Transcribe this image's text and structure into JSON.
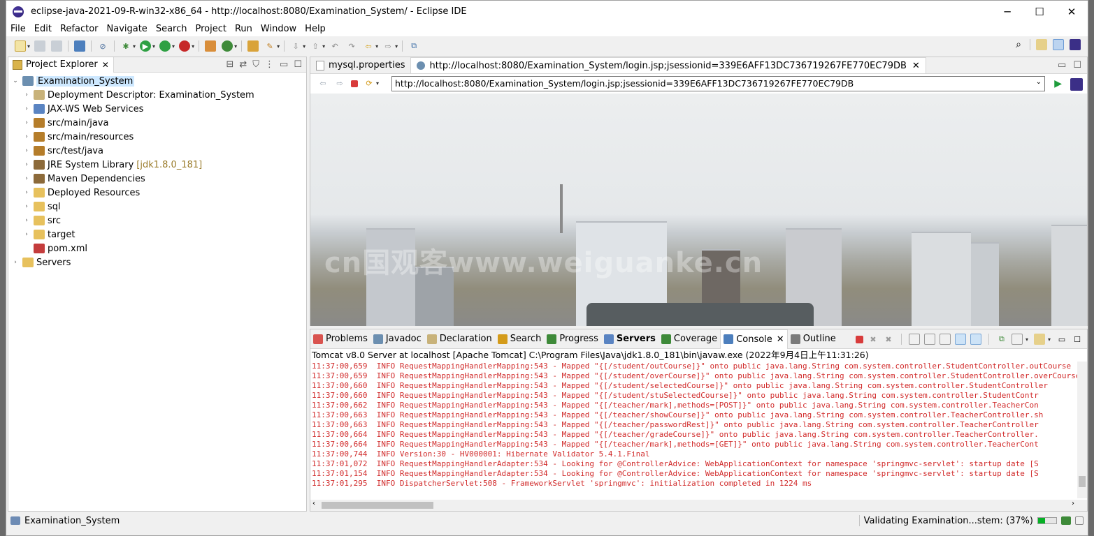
{
  "window": {
    "title": "eclipse-java-2021-09-R-win32-x86_64 - http://localhost:8080/Examination_System/ - Eclipse IDE",
    "controls": {
      "minimize": "─",
      "maximize": "☐",
      "close": "✕"
    }
  },
  "menu": [
    "File",
    "Edit",
    "Refactor",
    "Navigate",
    "Search",
    "Project",
    "Run",
    "Window",
    "Help"
  ],
  "project_explorer": {
    "tab_label": "Project Explorer",
    "tree": [
      {
        "label": "Examination_System",
        "level": 0,
        "expanded": true,
        "selected": true,
        "icon": "project-icon"
      },
      {
        "label": "Deployment Descriptor: Examination_System",
        "level": 1,
        "icon": "descriptor-icon"
      },
      {
        "label": "JAX-WS Web Services",
        "level": 1,
        "icon": "webservice-icon"
      },
      {
        "label": "src/main/java",
        "level": 1,
        "icon": "source-folder-icon"
      },
      {
        "label": "src/main/resources",
        "level": 1,
        "icon": "source-folder-icon"
      },
      {
        "label": "src/test/java",
        "level": 1,
        "icon": "source-folder-icon"
      },
      {
        "label": "JRE System Library",
        "decoration": "[jdk1.8.0_181]",
        "level": 1,
        "icon": "library-icon"
      },
      {
        "label": "Maven Dependencies",
        "level": 1,
        "icon": "library-icon"
      },
      {
        "label": "Deployed Resources",
        "level": 1,
        "icon": "folder-icon"
      },
      {
        "label": "sql",
        "level": 1,
        "icon": "folder-icon"
      },
      {
        "label": "src",
        "level": 1,
        "icon": "folder-icon"
      },
      {
        "label": "target",
        "level": 1,
        "icon": "folder-icon"
      },
      {
        "label": "pom.xml",
        "level": 1,
        "leaf": true,
        "icon": "xml-file-icon"
      },
      {
        "label": "Servers",
        "level": 0,
        "icon": "folder-icon"
      }
    ]
  },
  "editor": {
    "tabs": [
      {
        "label": "mysql.properties",
        "active": false
      },
      {
        "label": "http://localhost:8080/Examination_System/login.jsp;jsessionid=339E6AFF13DC736719267FE770EC79DB",
        "active": true
      }
    ],
    "url": "http://localhost:8080/Examination_System/login.jsp;jsessionid=339E6AFF13DC736719267FE770EC79DB",
    "watermark": "cn国观客www.weiguanke.cn"
  },
  "bottom_panel": {
    "tabs": [
      {
        "label": "Problems",
        "icon": "problems-icon"
      },
      {
        "label": "Javadoc",
        "icon": "javadoc-icon"
      },
      {
        "label": "Declaration",
        "icon": "declaration-icon"
      },
      {
        "label": "Search",
        "icon": "search-icon"
      },
      {
        "label": "Progress",
        "icon": "progress-icon"
      },
      {
        "label": "Servers",
        "icon": "servers-icon",
        "bold": true
      },
      {
        "label": "Coverage",
        "icon": "coverage-icon"
      },
      {
        "label": "Console",
        "icon": "console-icon",
        "active": true
      },
      {
        "label": "Outline",
        "icon": "outline-icon"
      }
    ],
    "console_description": "Tomcat v8.0 Server at localhost [Apache Tomcat] C:\\Program Files\\Java\\jdk1.8.0_181\\bin\\javaw.exe  (2022年9月4日上午11:31:26)",
    "lines": [
      "11:37:00,659  INFO RequestMappingHandlerMapping:543 - Mapped \"{[/student/outCourse]}\" onto public java.lang.String com.system.controller.StudentController.outCourse",
      "11:37:00,659  INFO RequestMappingHandlerMapping:543 - Mapped \"{[/student/overCourse]}\" onto public java.lang.String com.system.controller.StudentController.overCourse",
      "11:37:00,660  INFO RequestMappingHandlerMapping:543 - Mapped \"{[/student/selectedCourse]}\" onto public java.lang.String com.system.controller.StudentController",
      "11:37:00,660  INFO RequestMappingHandlerMapping:543 - Mapped \"{[/student/stuSelectedCourse]}\" onto public java.lang.String com.system.controller.StudentContr",
      "11:37:00,662  INFO RequestMappingHandlerMapping:543 - Mapped \"{[/teacher/mark],methods=[POST]}\" onto public java.lang.String com.system.controller.TeacherCon",
      "11:37:00,663  INFO RequestMappingHandlerMapping:543 - Mapped \"{[/teacher/showCourse]}\" onto public java.lang.String com.system.controller.TeacherController.sh",
      "11:37:00,663  INFO RequestMappingHandlerMapping:543 - Mapped \"{[/teacher/passwordRest]}\" onto public java.lang.String com.system.controller.TeacherController",
      "11:37:00,664  INFO RequestMappingHandlerMapping:543 - Mapped \"{[/teacher/gradeCourse]}\" onto public java.lang.String com.system.controller.TeacherController.",
      "11:37:00,664  INFO RequestMappingHandlerMapping:543 - Mapped \"{[/teacher/mark],methods=[GET]}\" onto public java.lang.String com.system.controller.TeacherCont",
      "11:37:00,744  INFO Version:30 - HV000001: Hibernate Validator 5.4.1.Final",
      "11:37:01,072  INFO RequestMappingHandlerAdapter:534 - Looking for @ControllerAdvice: WebApplicationContext for namespace 'springmvc-servlet': startup date [S",
      "11:37:01,154  INFO RequestMappingHandlerAdapter:534 - Looking for @ControllerAdvice: WebApplicationContext for namespace 'springmvc-servlet': startup date [S",
      "11:37:01,295  INFO DispatcherServlet:508 - FrameworkServlet 'springmvc': initialization completed in 1224 ms"
    ]
  },
  "status": {
    "left": "Examination_System",
    "right": "Validating Examination...stem: (37%)",
    "progress": 0.37
  }
}
